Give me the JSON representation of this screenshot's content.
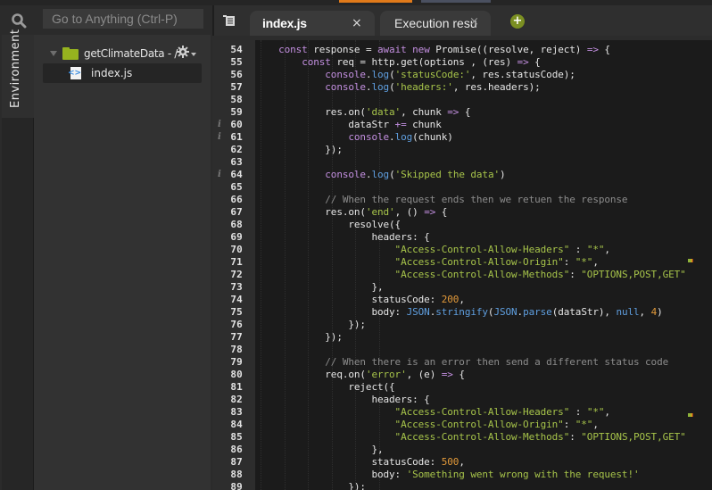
{
  "app": {
    "search": {
      "placeholder": "Go to Anything (Ctrl-P)",
      "icon": "search-icon"
    },
    "side_tab": {
      "label": "Environment"
    }
  },
  "file_tree": {
    "root": {
      "label": "getClimateData - /",
      "icon": "folder-icon"
    },
    "settings_icon": "gear-icon",
    "files": [
      {
        "label": "index.js",
        "icon": "js-file-icon",
        "selected": true
      }
    ]
  },
  "tabs": {
    "list_icon": "tab-list-icon",
    "items": [
      {
        "label": "index.js",
        "active": true,
        "close": "×"
      },
      {
        "label": "Execution results",
        "active": false,
        "close": "×"
      }
    ],
    "add_label": "+"
  },
  "editor": {
    "language": "javascript",
    "info_marker": "i",
    "colors": {
      "keyword": "#c38fe0",
      "function": "#5f9fe0",
      "string": "#a7c44a",
      "number": "#e39a3a",
      "comment": "#8c8c8c",
      "text": "#e6e6e6"
    },
    "lines": [
      {
        "n": "54",
        "info": false,
        "tokens": [
          [
            "",
            "    "
          ],
          [
            "kw",
            "const"
          ],
          [
            "",
            " response = "
          ],
          [
            "kw",
            "await"
          ],
          [
            "",
            " "
          ],
          [
            "kw",
            "new"
          ],
          [
            "",
            " Promise((resolve, reject) "
          ],
          [
            "op",
            "=>"
          ],
          [
            "",
            " {"
          ]
        ]
      },
      {
        "n": "55",
        "info": false,
        "tokens": [
          [
            "",
            "        "
          ],
          [
            "kw",
            "const"
          ],
          [
            "",
            " req = http.get(options , (res) "
          ],
          [
            "op",
            "=>"
          ],
          [
            "",
            " {"
          ]
        ]
      },
      {
        "n": "56",
        "info": false,
        "tokens": [
          [
            "",
            "            "
          ],
          [
            "kw",
            "console"
          ],
          [
            "",
            "."
          ],
          [
            "fn",
            "log"
          ],
          [
            "",
            "("
          ],
          [
            "str",
            "'statusCode:'"
          ],
          [
            "",
            ", res.statusCode);"
          ]
        ]
      },
      {
        "n": "57",
        "info": false,
        "tokens": [
          [
            "",
            "            "
          ],
          [
            "kw",
            "console"
          ],
          [
            "",
            "."
          ],
          [
            "fn",
            "log"
          ],
          [
            "",
            "("
          ],
          [
            "str",
            "'headers:'"
          ],
          [
            "",
            ", res.headers);"
          ]
        ]
      },
      {
        "n": "58",
        "info": false,
        "tokens": []
      },
      {
        "n": "59",
        "info": false,
        "tokens": [
          [
            "",
            "            res.on("
          ],
          [
            "str",
            "'data'"
          ],
          [
            "",
            ", chunk "
          ],
          [
            "op",
            "=>"
          ],
          [
            "",
            " {"
          ]
        ]
      },
      {
        "n": "60",
        "info": true,
        "tokens": [
          [
            "",
            "                dataStr "
          ],
          [
            "op",
            "+="
          ],
          [
            "",
            " chunk"
          ]
        ]
      },
      {
        "n": "61",
        "info": true,
        "tokens": [
          [
            "",
            "                "
          ],
          [
            "kw",
            "console"
          ],
          [
            "",
            "."
          ],
          [
            "fn",
            "log"
          ],
          [
            "",
            "(chunk)"
          ]
        ]
      },
      {
        "n": "62",
        "info": false,
        "tokens": [
          [
            "",
            "            });"
          ]
        ]
      },
      {
        "n": "63",
        "info": false,
        "tokens": []
      },
      {
        "n": "64",
        "info": true,
        "tokens": [
          [
            "",
            "            "
          ],
          [
            "kw",
            "console"
          ],
          [
            "",
            "."
          ],
          [
            "fn",
            "log"
          ],
          [
            "",
            "("
          ],
          [
            "str",
            "'Skipped the data'"
          ],
          [
            "",
            ")"
          ]
        ]
      },
      {
        "n": "65",
        "info": false,
        "tokens": []
      },
      {
        "n": "66",
        "info": false,
        "tokens": [
          [
            "",
            "            "
          ],
          [
            "cmt",
            "// When the request ends then we retuen the response"
          ]
        ]
      },
      {
        "n": "67",
        "info": false,
        "tokens": [
          [
            "",
            "            res.on("
          ],
          [
            "str",
            "'end'"
          ],
          [
            "",
            ", () "
          ],
          [
            "op",
            "=>"
          ],
          [
            "",
            " {"
          ]
        ]
      },
      {
        "n": "68",
        "info": false,
        "tokens": [
          [
            "",
            "                resolve({"
          ]
        ]
      },
      {
        "n": "69",
        "info": false,
        "tokens": [
          [
            "",
            "                    headers: {"
          ]
        ]
      },
      {
        "n": "70",
        "info": false,
        "tokens": [
          [
            "",
            "                        "
          ],
          [
            "str",
            "\"Access-Control-Allow-Headers\""
          ],
          [
            "",
            " : "
          ],
          [
            "str",
            "\"*\""
          ],
          [
            "",
            ","
          ]
        ]
      },
      {
        "n": "71",
        "info": false,
        "tokens": [
          [
            "",
            "                        "
          ],
          [
            "str",
            "\"Access-Control-Allow-Origin\""
          ],
          [
            "",
            ": "
          ],
          [
            "str",
            "\"*\""
          ],
          [
            "",
            ","
          ]
        ]
      },
      {
        "n": "72",
        "info": false,
        "tokens": [
          [
            "",
            "                        "
          ],
          [
            "str",
            "\"Access-Control-Allow-Methods\""
          ],
          [
            "",
            ": "
          ],
          [
            "str",
            "\"OPTIONS,POST,GET\""
          ]
        ]
      },
      {
        "n": "73",
        "info": false,
        "tokens": [
          [
            "",
            "                    },"
          ]
        ]
      },
      {
        "n": "74",
        "info": false,
        "tokens": [
          [
            "",
            "                    statusCode: "
          ],
          [
            "num",
            "200"
          ],
          [
            "",
            ","
          ]
        ]
      },
      {
        "n": "75",
        "info": false,
        "tokens": [
          [
            "",
            "                    body: "
          ],
          [
            "fn",
            "JSON"
          ],
          [
            "",
            "."
          ],
          [
            "fn",
            "stringify"
          ],
          [
            "",
            "("
          ],
          [
            "fn",
            "JSON"
          ],
          [
            "",
            "."
          ],
          [
            "fn",
            "parse"
          ],
          [
            "",
            "(dataStr), "
          ],
          [
            "fn",
            "null"
          ],
          [
            "",
            ", "
          ],
          [
            "num",
            "4"
          ],
          [
            "",
            ")"
          ]
        ]
      },
      {
        "n": "76",
        "info": false,
        "tokens": [
          [
            "",
            "                });"
          ]
        ]
      },
      {
        "n": "77",
        "info": false,
        "tokens": [
          [
            "",
            "            });"
          ]
        ]
      },
      {
        "n": "78",
        "info": false,
        "tokens": []
      },
      {
        "n": "79",
        "info": false,
        "tokens": [
          [
            "",
            "            "
          ],
          [
            "cmt",
            "// When there is an error then send a different status code"
          ]
        ]
      },
      {
        "n": "80",
        "info": false,
        "tokens": [
          [
            "",
            "            req.on("
          ],
          [
            "str",
            "'error'"
          ],
          [
            "",
            ", (e) "
          ],
          [
            "op",
            "=>"
          ],
          [
            "",
            " {"
          ]
        ]
      },
      {
        "n": "81",
        "info": false,
        "tokens": [
          [
            "",
            "                reject({"
          ]
        ]
      },
      {
        "n": "82",
        "info": false,
        "tokens": [
          [
            "",
            "                    headers: {"
          ]
        ]
      },
      {
        "n": "83",
        "info": false,
        "tokens": [
          [
            "",
            "                        "
          ],
          [
            "str",
            "\"Access-Control-Allow-Headers\""
          ],
          [
            "",
            " : "
          ],
          [
            "str",
            "\"*\""
          ],
          [
            "",
            ","
          ]
        ]
      },
      {
        "n": "84",
        "info": false,
        "tokens": [
          [
            "",
            "                        "
          ],
          [
            "str",
            "\"Access-Control-Allow-Origin\""
          ],
          [
            "",
            ": "
          ],
          [
            "str",
            "\"*\""
          ],
          [
            "",
            ","
          ]
        ]
      },
      {
        "n": "85",
        "info": false,
        "tokens": [
          [
            "",
            "                        "
          ],
          [
            "str",
            "\"Access-Control-Allow-Methods\""
          ],
          [
            "",
            ": "
          ],
          [
            "str",
            "\"OPTIONS,POST,GET\""
          ]
        ]
      },
      {
        "n": "86",
        "info": false,
        "tokens": [
          [
            "",
            "                    },"
          ]
        ]
      },
      {
        "n": "87",
        "info": false,
        "tokens": [
          [
            "",
            "                    statusCode: "
          ],
          [
            "num",
            "500"
          ],
          [
            "",
            ","
          ]
        ]
      },
      {
        "n": "88",
        "info": false,
        "tokens": [
          [
            "",
            "                    body: "
          ],
          [
            "str",
            "'Something went wrong with the request!'"
          ]
        ]
      },
      {
        "n": "89",
        "info": false,
        "tokens": [
          [
            "",
            "                });"
          ]
        ]
      }
    ]
  }
}
